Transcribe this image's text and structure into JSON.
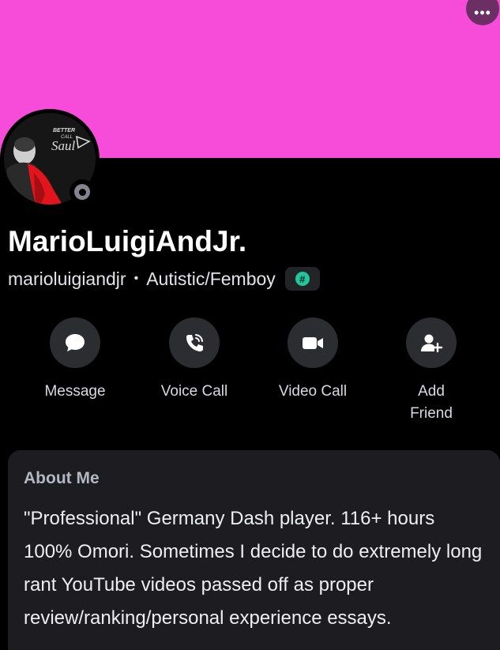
{
  "banner": {
    "color": "#f74bd9"
  },
  "header": {
    "more_label": "•••",
    "more_icon": "more-horizontal-icon"
  },
  "profile": {
    "display_name": "MarioLuigiAndJr.",
    "username": "marioluigiandjr",
    "separator": "•",
    "pronouns": "Autistic/Femboy",
    "badge_symbol": "#",
    "status": "offline"
  },
  "actions": [
    {
      "label": "Message",
      "icon": "message-bubble-icon"
    },
    {
      "label": "Voice Call",
      "icon": "phone-call-icon"
    },
    {
      "label": "Video Call",
      "icon": "video-camera-icon"
    },
    {
      "label": "Add\nFriend",
      "icon": "add-friend-icon"
    }
  ],
  "about": {
    "title": "About Me",
    "body": "\"Professional\" Germany Dash player. 116+ hours 100% Omori. Sometimes I decide to do extremely long rant YouTube videos passed off as proper review/ranking/personal experience essays."
  }
}
